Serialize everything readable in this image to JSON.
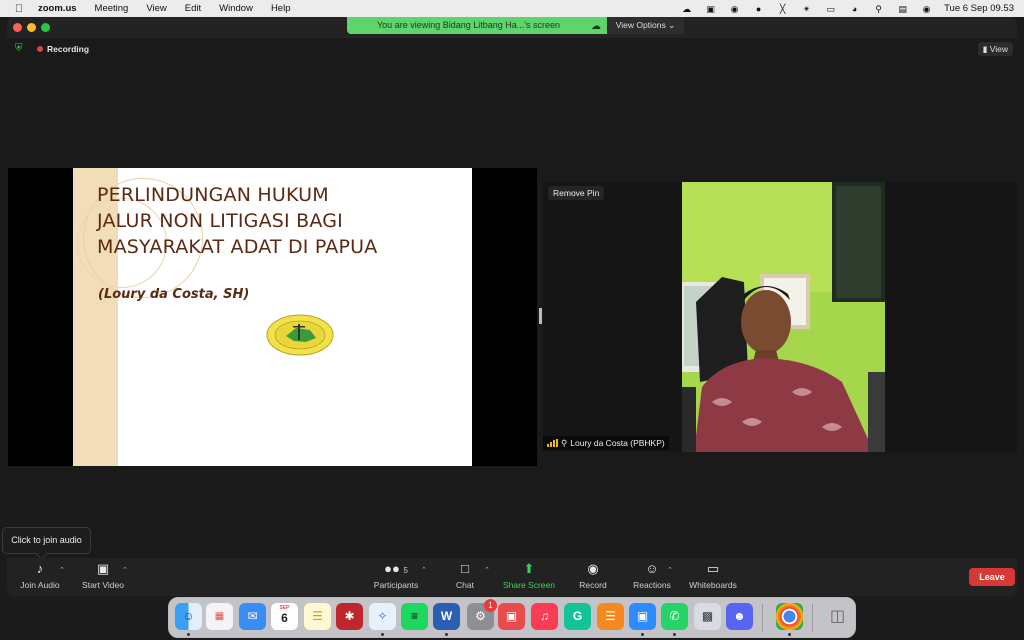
{
  "menubar": {
    "app_name": "zoom.us",
    "menus": [
      "Meeting",
      "View",
      "Edit",
      "Window",
      "Help"
    ],
    "clock": "Tue 6 Sep  09.53"
  },
  "banner": {
    "viewing_text": "You are viewing Bidang Litbang Ha...'s screen",
    "view_options": "View Options"
  },
  "meeting": {
    "recording_label": "Recording",
    "view_label": "View"
  },
  "slide": {
    "title_lines": [
      "PERLINDUNGAN HUKUM",
      "JALUR NON LITIGASI BAGI",
      "MASYARAKAT ADAT DI PAPUA"
    ],
    "author": "(Loury da Costa, SH)",
    "accent_color": "#5a2a15"
  },
  "video_tile": {
    "remove_pin": "Remove Pin",
    "participant_name": "Loury da Costa (PBHKP)"
  },
  "tooltip": {
    "text": "Click to join audio"
  },
  "toolbar": {
    "join_audio": "Join Audio",
    "start_video": "Start Video",
    "participants": "Participants",
    "participants_count": "5",
    "chat": "Chat",
    "share_screen": "Share Screen",
    "record": "Record",
    "reactions": "Reactions",
    "whiteboards": "Whiteboards",
    "leave": "Leave",
    "share_color": "#3bd45a",
    "leave_color": "#d63a36"
  },
  "dock": {
    "calendar_month": "SEP",
    "calendar_day": "6",
    "notification_badge": "1"
  }
}
